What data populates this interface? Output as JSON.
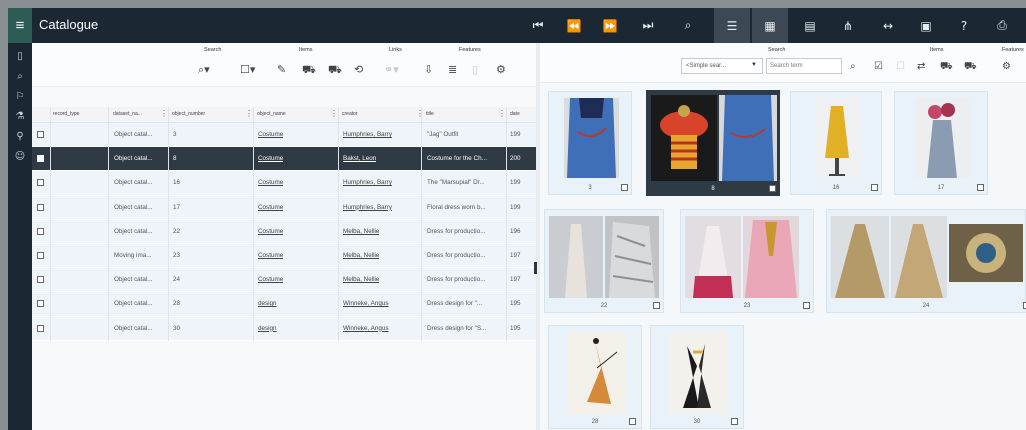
{
  "app": {
    "title": "Catalogue"
  },
  "left_toolbar": {
    "groups": {
      "search": "Search",
      "items": "Items",
      "links": "Links",
      "features": "Features"
    }
  },
  "grid": {
    "columns": [
      "record_type",
      "dataset_na...",
      "object_number",
      "object_name",
      "creator",
      "title",
      "date"
    ],
    "rows": [
      {
        "dataset": "Object catal...",
        "number": "3",
        "name": "Costume",
        "creator": "Humphries, Barry",
        "title": "\"Jag\" Outfit",
        "date": "199",
        "selected": false
      },
      {
        "dataset": "Object catal...",
        "number": "8",
        "name": "Costume",
        "creator": "Bakst, Leon",
        "title": "Costume for the Ch...",
        "date": "200",
        "selected": true
      },
      {
        "dataset": "Object catal...",
        "number": "16",
        "name": "Costume",
        "creator": "Humphries, Barry",
        "title": "The \"Marsupial\" Dr...",
        "date": "199",
        "selected": false
      },
      {
        "dataset": "Object catal...",
        "number": "17",
        "name": "Costume",
        "creator": "Humphries, Barry",
        "title": "Floral dress worn b...",
        "date": "199",
        "selected": false
      },
      {
        "dataset": "Object catal...",
        "number": "22",
        "name": "Costume",
        "creator": "Melba, Nellie",
        "title": "Dress for productio...",
        "date": "196",
        "selected": false
      },
      {
        "dataset": "Moving ima...",
        "number": "23",
        "name": "Costume",
        "creator": "Melba, Nellie",
        "title": "Dress for productio...",
        "date": "197",
        "selected": false
      },
      {
        "dataset": "Object catal...",
        "number": "24",
        "name": "Costume",
        "creator": "Melba, Nellie",
        "title": "Dress for productio...",
        "date": "197",
        "selected": false
      },
      {
        "dataset": "Object catal...",
        "number": "28",
        "name": "design",
        "creator": "Winneke, Angus",
        "title": "Dress design for \"...",
        "date": "195",
        "selected": false
      },
      {
        "dataset": "Object catal...",
        "number": "30",
        "name": "design",
        "creator": "Winneke, Angus",
        "title": "Dress design for \"S...",
        "date": "195",
        "selected": false
      }
    ]
  },
  "right_toolbar": {
    "groups": {
      "search": "Search",
      "items": "Items",
      "features": "Features"
    },
    "mode_select": "<Simple sear...",
    "search_placeholder": "Search term"
  },
  "cards": [
    {
      "number": "3",
      "selected": false
    },
    {
      "number": "8",
      "selected": true
    },
    {
      "number": "16",
      "selected": false
    },
    {
      "number": "17",
      "selected": false
    },
    {
      "number": "22",
      "selected": false
    },
    {
      "number": "23",
      "selected": false
    },
    {
      "number": "24",
      "selected": false
    },
    {
      "number": "28",
      "selected": false
    },
    {
      "number": "30",
      "selected": false
    }
  ],
  "icons": {
    "menu": "hamburger-icon",
    "first": "first-record-icon",
    "prev": "previous-record-icon",
    "next": "next-record-icon",
    "last": "last-record-icon",
    "search": "search-icon",
    "list_view": "list-view-icon",
    "grid_view": "grid-view-icon",
    "detail_view": "document-icon",
    "hierarchy": "hierarchy-icon",
    "split": "split-view-icon",
    "filmstrip": "filmstrip-icon",
    "help": "help-icon",
    "print": "print-icon"
  },
  "colors": {
    "topbar": "#1b2834",
    "accent": "#2d5c54",
    "selected": "#2e3a44",
    "row": "#eef4fa"
  }
}
